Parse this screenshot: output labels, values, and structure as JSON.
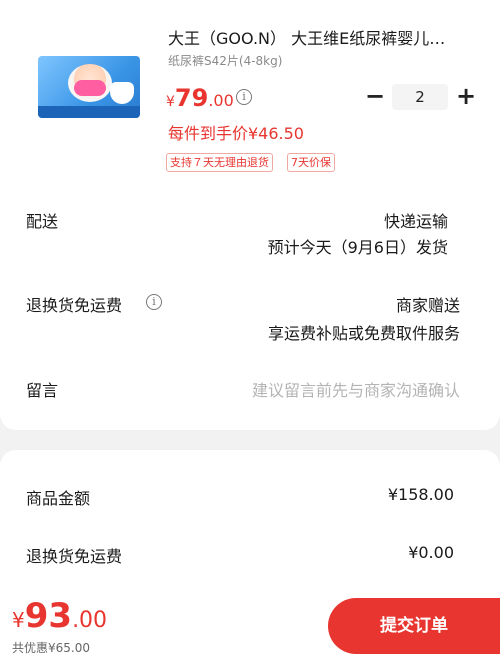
{
  "product": {
    "image_icon": "diaper-package-image",
    "title": "大王（GOO.N） 大王维E纸尿裤婴儿…",
    "spec": "纸尿裤S42片(4-8kg)",
    "price_currency": "¥",
    "price_int": "79",
    "price_dec": ".00",
    "price_info_icon": "info-icon",
    "quantity": "2",
    "minus_label": "−",
    "plus_label": "+",
    "each_price": "每件到手价¥46.50",
    "tags": [
      "支持７天无理由退货",
      "7天价保"
    ]
  },
  "delivery": {
    "label": "配送",
    "method": "快递运输",
    "estimate": "预计今天（9月6日）发货"
  },
  "return_shipping": {
    "label": "退换货免运费",
    "info_icon": "info-icon",
    "value": "商家赠送",
    "detail": "享运费补贴或免费取件服务"
  },
  "message": {
    "label": "留言",
    "placeholder": "建议留言前先与商家沟通确认"
  },
  "summary": {
    "rows": [
      {
        "label": "商品金额",
        "value": "¥158.00"
      },
      {
        "label": "退换货免运费",
        "value": "¥0.00"
      }
    ]
  },
  "footer": {
    "currency": "¥",
    "total_int": "93",
    "total_dec": ".00",
    "discount": "共优惠¥65.00",
    "submit_label": "提交订单"
  },
  "colors": {
    "accent": "#e8352f",
    "background": "#f2f2f2"
  }
}
